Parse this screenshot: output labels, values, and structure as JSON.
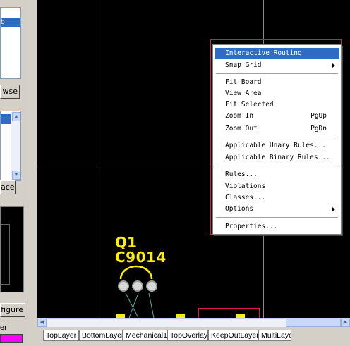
{
  "left_panel": {
    "list1_selected": "b",
    "browse_button": "wse",
    "replace_button": "ace",
    "configure_button": "figure",
    "layer_label": "er",
    "scroll_up": "▲",
    "scroll_down": "▼",
    "layer_color": "#ff00ff"
  },
  "silkscreen": {
    "designator": "Q1",
    "comment": "C9014"
  },
  "context_menu": {
    "items": [
      {
        "label": "Interactive Routing",
        "highlighted": true
      },
      {
        "label": "Snap Grid",
        "submenu": true
      },
      {
        "label": "Fit Board"
      },
      {
        "label": "View Area"
      },
      {
        "label": "Fit Selected"
      },
      {
        "label": "Zoom In",
        "shortcut": "PgUp"
      },
      {
        "label": "Zoom Out",
        "shortcut": "PgDn"
      },
      {
        "label": "Applicable Unary Rules..."
      },
      {
        "label": "Applicable Binary Rules..."
      },
      {
        "label": "Rules..."
      },
      {
        "label": "Violations"
      },
      {
        "label": "Classes..."
      },
      {
        "label": "Options",
        "submenu": true
      },
      {
        "label": "Properties..."
      }
    ]
  },
  "scrollbar": {
    "left": "◀",
    "right": "▶"
  },
  "layer_tabs": [
    "TopLayer",
    "BottomLayer",
    "Mechanical1",
    "TopOverlay",
    "KeepOutLayer",
    "MultiLayer"
  ],
  "colors": {
    "canvas": "#000000",
    "silkscreen": "#ffee00",
    "highlight": "#316ac5",
    "annotation_box": "#d8184a"
  }
}
